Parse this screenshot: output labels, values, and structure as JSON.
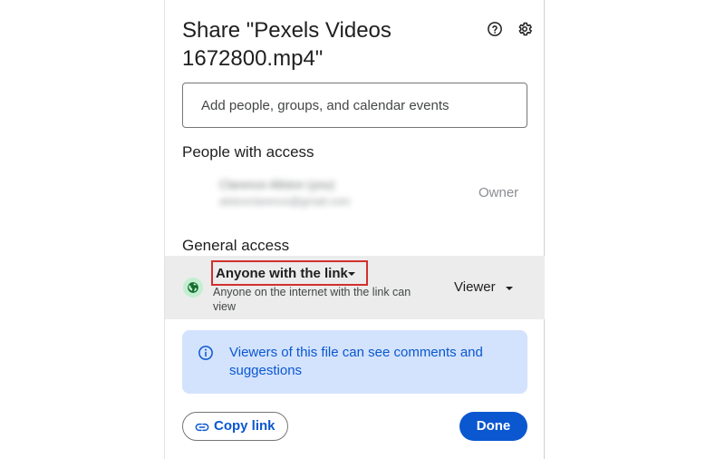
{
  "dialog": {
    "title": "Share \"Pexels Videos 1672800.mp4\"",
    "help_icon": "help-circle-icon",
    "settings_icon": "gear-icon"
  },
  "add_people": {
    "placeholder": "Add people, groups, and calendar events"
  },
  "people_with_access": {
    "heading": "People with access",
    "person": {
      "name": "Clarence Allston (you)",
      "email": "alstonclarence@gmail.com",
      "role": "Owner"
    }
  },
  "general_access": {
    "heading": "General access",
    "icon": "globe-icon",
    "access_label": "Anyone with the link",
    "description": "Anyone on the internet with the link can view",
    "role_label": "Viewer"
  },
  "info": {
    "icon": "info-icon",
    "text": "Viewers of this file can see comments and suggestions"
  },
  "footer": {
    "copy_link_label": "Copy link",
    "copy_link_icon": "link-icon",
    "done_label": "Done"
  },
  "colors": {
    "accent": "#0b57d0",
    "info_bg": "#d3e3fd",
    "highlight_border": "#d32f2f",
    "row_bg": "#ececec",
    "globe_bg": "#c4eed0"
  }
}
